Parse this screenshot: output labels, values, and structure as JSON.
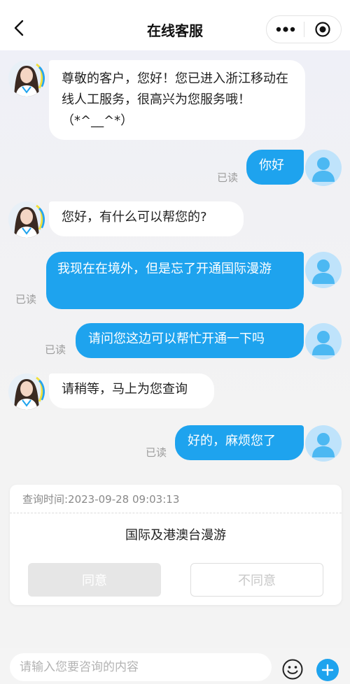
{
  "header": {
    "title": "在线客服"
  },
  "messages": [
    {
      "from": "agent",
      "text": "尊敬的客户，您好！您已进入浙江移动在线人工服务，很高兴为您服务哦！（*^__^*）"
    },
    {
      "from": "user",
      "text": "你好",
      "status": "已读"
    },
    {
      "from": "agent",
      "text": "您好，有什么可以帮您的?"
    },
    {
      "from": "user",
      "text": "我现在在境外，但是忘了开通国际漫游",
      "status": "已读"
    },
    {
      "from": "user",
      "text": "请问您这边可以帮忙开通一下吗",
      "status": "已读"
    },
    {
      "from": "agent",
      "text": "请稍等，马上为您查询"
    },
    {
      "from": "user",
      "text": "好的，麻烦您了",
      "status": "已读"
    }
  ],
  "card": {
    "time": "查询时间:2023-09-28 09:03:13",
    "title": "国际及港澳台漫游",
    "agree_label": "同意",
    "disagree_label": "不同意"
  },
  "input": {
    "placeholder": "请输入您要咨询的内容"
  },
  "colors": {
    "accent": "#1ea3ee",
    "user_bubble": "#1ea3ee",
    "agent_bubble": "#ffffff",
    "read_text": "#9c9c9c"
  },
  "icons": [
    "back-icon",
    "more-icon",
    "close-icon",
    "emoji-icon",
    "plus-icon",
    "agent-avatar",
    "user-avatar"
  ]
}
